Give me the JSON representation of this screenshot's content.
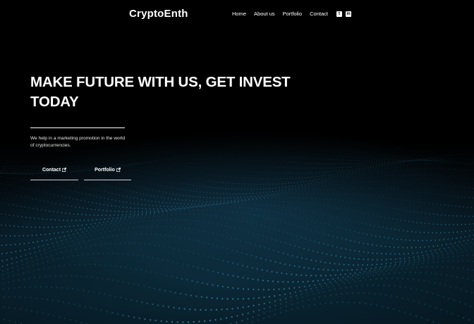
{
  "brand": {
    "logo_text": "CryptoEnth"
  },
  "nav": {
    "links": [
      {
        "label": "Home"
      },
      {
        "label": "About us"
      },
      {
        "label": "Portfolio"
      },
      {
        "label": "Contact"
      }
    ],
    "social": [
      {
        "icon": "twitter-icon",
        "glyph": "t"
      },
      {
        "icon": "linkedin-icon",
        "glyph": "in"
      }
    ]
  },
  "hero": {
    "headline": "MAKE FUTURE WITH US, GET INVEST TODAY",
    "tagline": "We help in a marketing promotion in the world of cryptocurrencies.",
    "buttons": [
      {
        "label": "Contact",
        "icon": "external-link-icon"
      },
      {
        "label": "Portfolio",
        "icon": "external-link-icon"
      }
    ]
  },
  "colors": {
    "background": "#000000",
    "accent_glow": "#164660",
    "text": "#ffffff"
  }
}
